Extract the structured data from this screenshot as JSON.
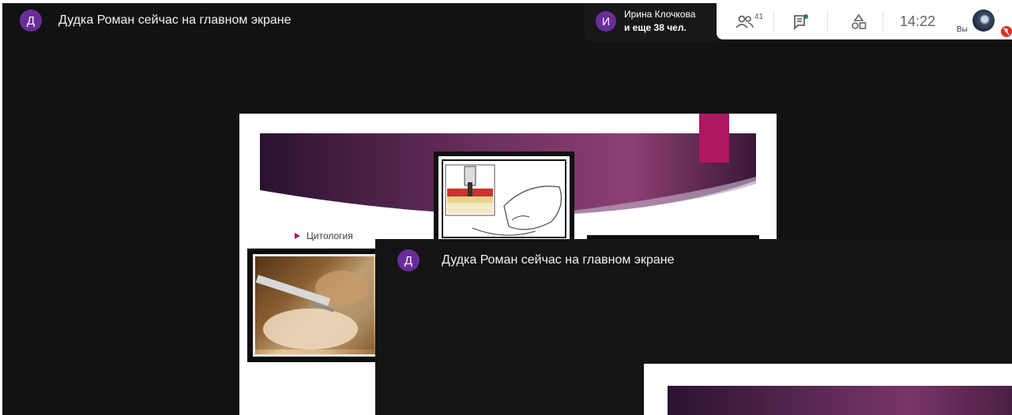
{
  "header": {
    "presenter_initial": "Д",
    "presenter_title": "Дудка Роман сейчас на главном экране"
  },
  "participants_chip": {
    "initial": "И",
    "name": "Ирина Клочкова",
    "others": "и еще 38 чел."
  },
  "controls": {
    "people_count": "41",
    "clock": "14:22",
    "you_label": "Вы",
    "icons": [
      "people-icon",
      "chat-icon",
      "activities-icon",
      "self-avatar",
      "mic-off-icon"
    ]
  },
  "slide": {
    "bullet_text": "Цитология",
    "accent_color": "#b01762",
    "banner_colors": [
      "#2b1230",
      "#6b2f5e",
      "#8d3f73"
    ]
  },
  "overlay": {
    "presenter_initial": "Д",
    "presenter_title": "Дудка Роман сейчас на главном экране"
  }
}
